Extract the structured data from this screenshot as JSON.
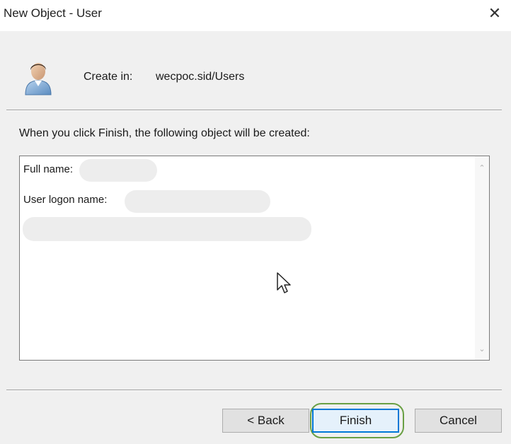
{
  "window": {
    "title": "New Object - User",
    "close_symbol": "✕"
  },
  "header": {
    "icon": "user-icon",
    "create_in_label": "Create in:",
    "create_in_path": "wecpoc.sid/Users"
  },
  "summary": {
    "intro": "When you click Finish, the following object will be created:",
    "full_name_label": "Full name:",
    "logon_name_label": "User logon name:",
    "scroll_up_symbol": "⌃",
    "scroll_down_symbol": "⌄"
  },
  "buttons": {
    "back": "< Back",
    "finish": "Finish",
    "cancel": "Cancel"
  },
  "colors": {
    "highlight_ring": "#6aa044",
    "default_button_border": "#0078d7"
  }
}
